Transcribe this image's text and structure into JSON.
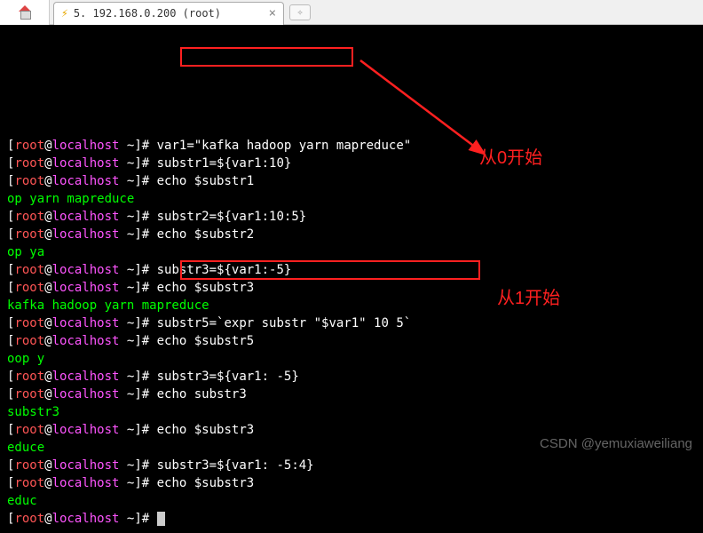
{
  "tab": {
    "title": "5. 192.168.0.200 (root)"
  },
  "prompt": {
    "user": "root",
    "at": "@",
    "host": "localhost",
    "tilde": " ~",
    "close": "]# "
  },
  "lines": [
    {
      "type": "cmd",
      "text": "var1=\"kafka hadoop yarn mapreduce\""
    },
    {
      "type": "cmd",
      "text": "substr1=${var1:10}"
    },
    {
      "type": "cmd",
      "text": "echo $substr1"
    },
    {
      "type": "out",
      "text": "op yarn mapreduce"
    },
    {
      "type": "cmd",
      "text": "substr2=${var1:10:5}"
    },
    {
      "type": "cmd",
      "text": "echo $substr2"
    },
    {
      "type": "out",
      "text": "op ya"
    },
    {
      "type": "cmd",
      "text": "substr3=${var1:-5}"
    },
    {
      "type": "cmd",
      "text": "echo $substr3"
    },
    {
      "type": "out",
      "text": "kafka hadoop yarn mapreduce"
    },
    {
      "type": "cmd",
      "text": "substr5=`expr substr \"$var1\" 10 5`"
    },
    {
      "type": "cmd",
      "text": "echo $substr5"
    },
    {
      "type": "out",
      "text": "oop y"
    },
    {
      "type": "cmd",
      "text": "substr3=${var1: -5}"
    },
    {
      "type": "cmd",
      "text": "echo substr3"
    },
    {
      "type": "out",
      "text": "substr3"
    },
    {
      "type": "cmd",
      "text": "echo $substr3"
    },
    {
      "type": "out",
      "text": "educe"
    },
    {
      "type": "cmd",
      "text": "substr3=${var1: -5:4}"
    },
    {
      "type": "cmd",
      "text": "echo $substr3"
    },
    {
      "type": "out",
      "text": "educ"
    },
    {
      "type": "cursor",
      "text": ""
    }
  ],
  "annotations": {
    "a1": "从0开始",
    "a2": "从1开始"
  },
  "watermark": "CSDN @yemuxiaweiliang"
}
